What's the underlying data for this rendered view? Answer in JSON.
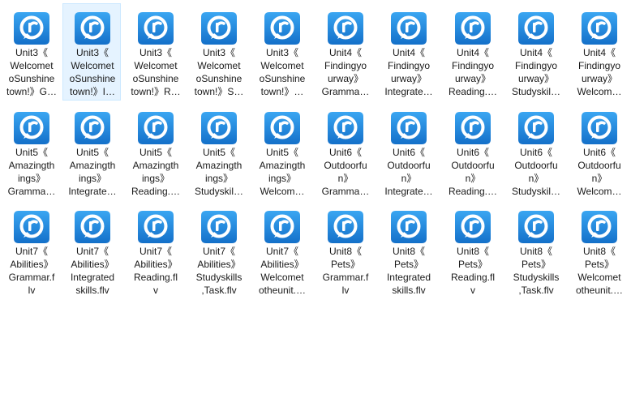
{
  "colors": {
    "icon_blue": "#1a8fe6",
    "icon_blue_dark": "#1470c9",
    "selection": "#e5f3ff"
  },
  "icon_name": "video-player-icon",
  "files": [
    {
      "label": "Unit3《\nWelcomet\noSunshine\ntown!》G…",
      "selected": false
    },
    {
      "label": "Unit3《\nWelcomet\noSunshine\ntown!》I…",
      "selected": true
    },
    {
      "label": "Unit3《\nWelcomet\noSunshine\ntown!》R…",
      "selected": false
    },
    {
      "label": "Unit3《\nWelcomet\noSunshine\ntown!》S…",
      "selected": false
    },
    {
      "label": "Unit3《\nWelcomet\noSunshine\ntown!》…",
      "selected": false
    },
    {
      "label": "Unit4《\nFindingyo\nurway》\nGramma…",
      "selected": false
    },
    {
      "label": "Unit4《\nFindingyo\nurway》\nIntegrate…",
      "selected": false
    },
    {
      "label": "Unit4《\nFindingyo\nurway》\nReading.…",
      "selected": false
    },
    {
      "label": "Unit4《\nFindingyo\nurway》\nStudyskil…",
      "selected": false
    },
    {
      "label": "Unit4《\nFindingyo\nurway》\nWelcom…",
      "selected": false
    },
    {
      "label": "Unit5《\nAmazingth\nings》\nGramma…",
      "selected": false
    },
    {
      "label": "Unit5《\nAmazingth\nings》\nIntegrate…",
      "selected": false
    },
    {
      "label": "Unit5《\nAmazingth\nings》\nReading.…",
      "selected": false
    },
    {
      "label": "Unit5《\nAmazingth\nings》\nStudyskil…",
      "selected": false
    },
    {
      "label": "Unit5《\nAmazingth\nings》\nWelcom…",
      "selected": false
    },
    {
      "label": "Unit6《\nOutdoorfu\nn》\nGramma…",
      "selected": false
    },
    {
      "label": "Unit6《\nOutdoorfu\nn》\nIntegrate…",
      "selected": false
    },
    {
      "label": "Unit6《\nOutdoorfu\nn》\nReading.…",
      "selected": false
    },
    {
      "label": "Unit6《\nOutdoorfu\nn》\nStudyskil…",
      "selected": false
    },
    {
      "label": "Unit6《\nOutdoorfu\nn》\nWelcom…",
      "selected": false
    },
    {
      "label": "Unit7《\nAbilities》\nGrammar.f\nlv",
      "selected": false
    },
    {
      "label": "Unit7《\nAbilities》\nIntegrated\nskills.flv",
      "selected": false
    },
    {
      "label": "Unit7《\nAbilities》\nReading.fl\nv",
      "selected": false
    },
    {
      "label": "Unit7《\nAbilities》\nStudyskills\n,Task.flv",
      "selected": false
    },
    {
      "label": "Unit7《\nAbilities》\nWelcomet\notheunit.…",
      "selected": false
    },
    {
      "label": "Unit8《\nPets》\nGrammar.f\nlv",
      "selected": false
    },
    {
      "label": "Unit8《\nPets》\nIntegrated\nskills.flv",
      "selected": false
    },
    {
      "label": "Unit8《\nPets》\nReading.fl\nv",
      "selected": false
    },
    {
      "label": "Unit8《\nPets》\nStudyskills\n,Task.flv",
      "selected": false
    },
    {
      "label": "Unit8《\nPets》\nWelcomet\notheunit.…",
      "selected": false
    }
  ]
}
